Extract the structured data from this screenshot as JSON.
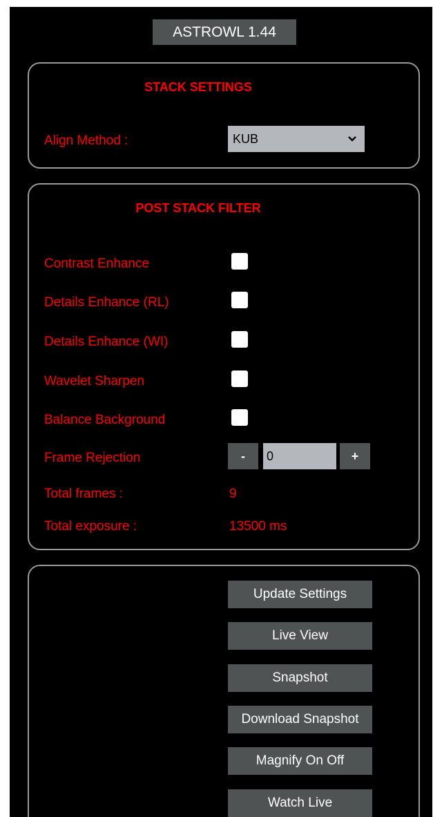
{
  "app": {
    "title": "ASTROWL 1.44"
  },
  "stack_settings": {
    "title": "STACK SETTINGS",
    "align_label": "Align Method :",
    "align_value": "KUB"
  },
  "post_stack_filter": {
    "title": "POST STACK FILTER",
    "filters": [
      {
        "label": "Contrast Enhance",
        "checked": false
      },
      {
        "label": "Details Enhance (RL)",
        "checked": false
      },
      {
        "label": "Details Enhance (WI)",
        "checked": false
      },
      {
        "label": "Wavelet Sharpen",
        "checked": false
      },
      {
        "label": "Balance Background",
        "checked": false
      }
    ],
    "frame_rejection": {
      "label": "Frame Rejection",
      "minus": "-",
      "value": "0",
      "plus": "+"
    },
    "total_frames_label": "Total frames :",
    "total_frames_value": "9",
    "total_exposure_label": "Total exposure :",
    "total_exposure_value": "13500 ms"
  },
  "actions": [
    "Update Settings",
    "Live View",
    "Snapshot",
    "Download Snapshot",
    "Magnify On Off",
    "Watch Live"
  ],
  "colors": {
    "background": "#000000",
    "text_red": "#ff0000",
    "button_gray": "#505354",
    "input_gray": "#b4b8bc",
    "panel_border": "#9a9a9a"
  }
}
